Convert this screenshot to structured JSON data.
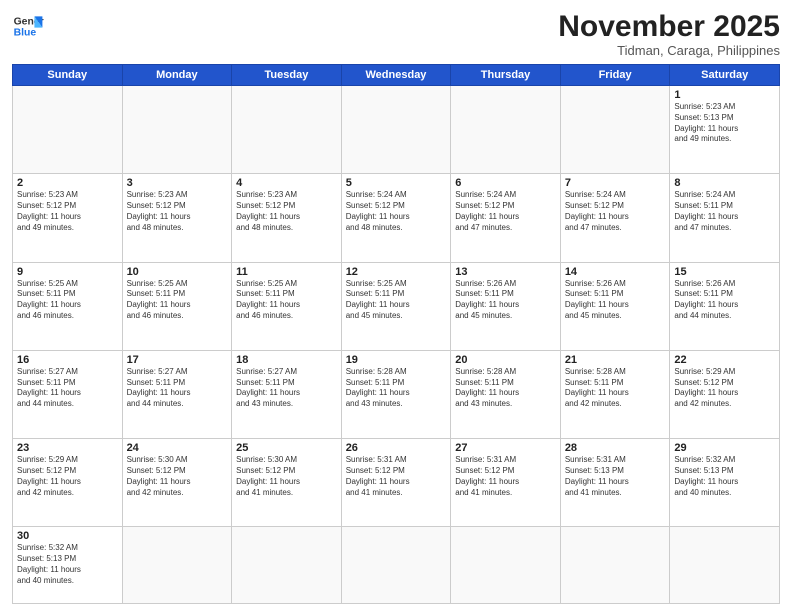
{
  "header": {
    "logo_general": "General",
    "logo_blue": "Blue",
    "month_title": "November 2025",
    "location": "Tidman, Caraga, Philippines"
  },
  "weekdays": [
    "Sunday",
    "Monday",
    "Tuesday",
    "Wednesday",
    "Thursday",
    "Friday",
    "Saturday"
  ],
  "weeks": [
    [
      {
        "day": "",
        "info": ""
      },
      {
        "day": "",
        "info": ""
      },
      {
        "day": "",
        "info": ""
      },
      {
        "day": "",
        "info": ""
      },
      {
        "day": "",
        "info": ""
      },
      {
        "day": "",
        "info": ""
      },
      {
        "day": "1",
        "info": "Sunrise: 5:23 AM\nSunset: 5:13 PM\nDaylight: 11 hours\nand 49 minutes."
      }
    ],
    [
      {
        "day": "2",
        "info": "Sunrise: 5:23 AM\nSunset: 5:12 PM\nDaylight: 11 hours\nand 49 minutes."
      },
      {
        "day": "3",
        "info": "Sunrise: 5:23 AM\nSunset: 5:12 PM\nDaylight: 11 hours\nand 48 minutes."
      },
      {
        "day": "4",
        "info": "Sunrise: 5:23 AM\nSunset: 5:12 PM\nDaylight: 11 hours\nand 48 minutes."
      },
      {
        "day": "5",
        "info": "Sunrise: 5:24 AM\nSunset: 5:12 PM\nDaylight: 11 hours\nand 48 minutes."
      },
      {
        "day": "6",
        "info": "Sunrise: 5:24 AM\nSunset: 5:12 PM\nDaylight: 11 hours\nand 47 minutes."
      },
      {
        "day": "7",
        "info": "Sunrise: 5:24 AM\nSunset: 5:12 PM\nDaylight: 11 hours\nand 47 minutes."
      },
      {
        "day": "8",
        "info": "Sunrise: 5:24 AM\nSunset: 5:11 PM\nDaylight: 11 hours\nand 47 minutes."
      }
    ],
    [
      {
        "day": "9",
        "info": "Sunrise: 5:25 AM\nSunset: 5:11 PM\nDaylight: 11 hours\nand 46 minutes."
      },
      {
        "day": "10",
        "info": "Sunrise: 5:25 AM\nSunset: 5:11 PM\nDaylight: 11 hours\nand 46 minutes."
      },
      {
        "day": "11",
        "info": "Sunrise: 5:25 AM\nSunset: 5:11 PM\nDaylight: 11 hours\nand 46 minutes."
      },
      {
        "day": "12",
        "info": "Sunrise: 5:25 AM\nSunset: 5:11 PM\nDaylight: 11 hours\nand 45 minutes."
      },
      {
        "day": "13",
        "info": "Sunrise: 5:26 AM\nSunset: 5:11 PM\nDaylight: 11 hours\nand 45 minutes."
      },
      {
        "day": "14",
        "info": "Sunrise: 5:26 AM\nSunset: 5:11 PM\nDaylight: 11 hours\nand 45 minutes."
      },
      {
        "day": "15",
        "info": "Sunrise: 5:26 AM\nSunset: 5:11 PM\nDaylight: 11 hours\nand 44 minutes."
      }
    ],
    [
      {
        "day": "16",
        "info": "Sunrise: 5:27 AM\nSunset: 5:11 PM\nDaylight: 11 hours\nand 44 minutes."
      },
      {
        "day": "17",
        "info": "Sunrise: 5:27 AM\nSunset: 5:11 PM\nDaylight: 11 hours\nand 44 minutes."
      },
      {
        "day": "18",
        "info": "Sunrise: 5:27 AM\nSunset: 5:11 PM\nDaylight: 11 hours\nand 43 minutes."
      },
      {
        "day": "19",
        "info": "Sunrise: 5:28 AM\nSunset: 5:11 PM\nDaylight: 11 hours\nand 43 minutes."
      },
      {
        "day": "20",
        "info": "Sunrise: 5:28 AM\nSunset: 5:11 PM\nDaylight: 11 hours\nand 43 minutes."
      },
      {
        "day": "21",
        "info": "Sunrise: 5:28 AM\nSunset: 5:11 PM\nDaylight: 11 hours\nand 42 minutes."
      },
      {
        "day": "22",
        "info": "Sunrise: 5:29 AM\nSunset: 5:12 PM\nDaylight: 11 hours\nand 42 minutes."
      }
    ],
    [
      {
        "day": "23",
        "info": "Sunrise: 5:29 AM\nSunset: 5:12 PM\nDaylight: 11 hours\nand 42 minutes."
      },
      {
        "day": "24",
        "info": "Sunrise: 5:30 AM\nSunset: 5:12 PM\nDaylight: 11 hours\nand 42 minutes."
      },
      {
        "day": "25",
        "info": "Sunrise: 5:30 AM\nSunset: 5:12 PM\nDaylight: 11 hours\nand 41 minutes."
      },
      {
        "day": "26",
        "info": "Sunrise: 5:31 AM\nSunset: 5:12 PM\nDaylight: 11 hours\nand 41 minutes."
      },
      {
        "day": "27",
        "info": "Sunrise: 5:31 AM\nSunset: 5:12 PM\nDaylight: 11 hours\nand 41 minutes."
      },
      {
        "day": "28",
        "info": "Sunrise: 5:31 AM\nSunset: 5:13 PM\nDaylight: 11 hours\nand 41 minutes."
      },
      {
        "day": "29",
        "info": "Sunrise: 5:32 AM\nSunset: 5:13 PM\nDaylight: 11 hours\nand 40 minutes."
      }
    ],
    [
      {
        "day": "30",
        "info": "Sunrise: 5:32 AM\nSunset: 5:13 PM\nDaylight: 11 hours\nand 40 minutes."
      },
      {
        "day": "",
        "info": ""
      },
      {
        "day": "",
        "info": ""
      },
      {
        "day": "",
        "info": ""
      },
      {
        "day": "",
        "info": ""
      },
      {
        "day": "",
        "info": ""
      },
      {
        "day": "",
        "info": ""
      }
    ]
  ]
}
